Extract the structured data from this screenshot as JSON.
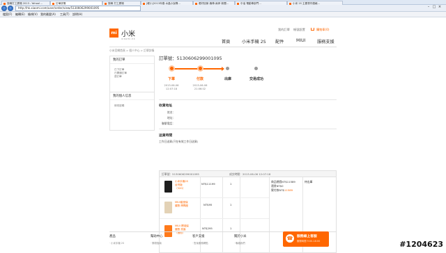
{
  "browser": {
    "tabs": [
      "搜尋打工廣場 2013 - Yahoo!...",
      "訂單詳情",
      "搜尋 打工廣場",
      "[輕小]2013年春 水晶小說專...",
      "看好回家-機車-兩岸 新聞...",
      "中油 電動車部門...",
      "小米 2S 主要零件價格..."
    ],
    "url": "http://hk.xiaomi.com/user/order/view/5130606299001095",
    "menu": [
      "檔案(F)",
      "編輯(E)",
      "檢視(V)",
      "我的最愛(A)",
      "工具(T)",
      "說明(H)"
    ],
    "window_controls": [
      "–",
      "□",
      "×"
    ]
  },
  "header": {
    "logo_text": "mi",
    "brand": "小米",
    "brand_sub": "xiaomi.hk",
    "top_links": [
      "我的訂單",
      "帳號設置"
    ],
    "cart": "購物車(0)",
    "nav": [
      "首頁",
      "小米手機 2S",
      "配件",
      "MIUI",
      "服務支援"
    ]
  },
  "breadcrumb": "小米官網首頁 > 個人中心 > 訂單詳情",
  "sidebar": {
    "orders_title": "我的訂單",
    "orders_links": [
      "已下訂單",
      "已開通訂單",
      "退訂單"
    ],
    "personal_title": "我的個人信息",
    "personal_links": [
      "修改密碼"
    ]
  },
  "order": {
    "number_label": "訂單號：5130606299001095",
    "steps": [
      {
        "label": "下單",
        "date": "2013-06-06",
        "time": "12:07:18",
        "status": "done"
      },
      {
        "label": "付款",
        "date": "2013-06-06",
        "time": "21:06:02",
        "status": "done"
      },
      {
        "label": "出庫",
        "status": "pending"
      },
      {
        "label": "交易成功",
        "status": "pending"
      }
    ],
    "shipping_title": "收貨地址",
    "shipping_fields": [
      "姓名：",
      "地址：",
      "聯繫電話："
    ],
    "delivery_title": "送貨時間",
    "delivery_value": "工作日送貨(只在有效工作日送貨)",
    "table_head": {
      "order_no": "訂單號：5130606299001095",
      "date": "成交時間：2013-06-06 12:07:18"
    },
    "items": [
      {
        "name": "小米手機2S 台灣版（32G）",
        "price": "NT$11199",
        "qty": "1",
        "color": "#1e1e1e"
      },
      {
        "name": "MIUI星座保護殼 摩羯座",
        "price": "NT$95",
        "qty": "1",
        "color": "#e3d2b6"
      },
      {
        "name": "MIUI 標准保護殼 亮面（橙色）",
        "price": "NT$295",
        "qty": "1",
        "color": "#ff7a1a"
      }
    ],
    "summary": {
      "total": "商品總價NT$11589",
      "shipping": "運費NT$0",
      "paid_prefix": "實付款NT$",
      "paid_amount": "11589"
    },
    "status": "待出庫"
  },
  "footer": {
    "columns": [
      {
        "title": "幫助中心",
        "sub": "‧ 購物指南"
      },
      {
        "title": "客戶支援",
        "sub": "‧ 售後服務網點"
      },
      {
        "title": "關於小米",
        "sub": "‧ 聯絡我們"
      }
    ],
    "left_title": "產品",
    "left_sub": "‧ 小米手機 2S",
    "promo_title": "服務線上客服",
    "promo_sub": "服務時間 9:00-18:00",
    "promo_icon": "headset-icon"
  },
  "watermark": "#1204623",
  "colors": {
    "accent": "#ff6700",
    "text": "#333333"
  }
}
